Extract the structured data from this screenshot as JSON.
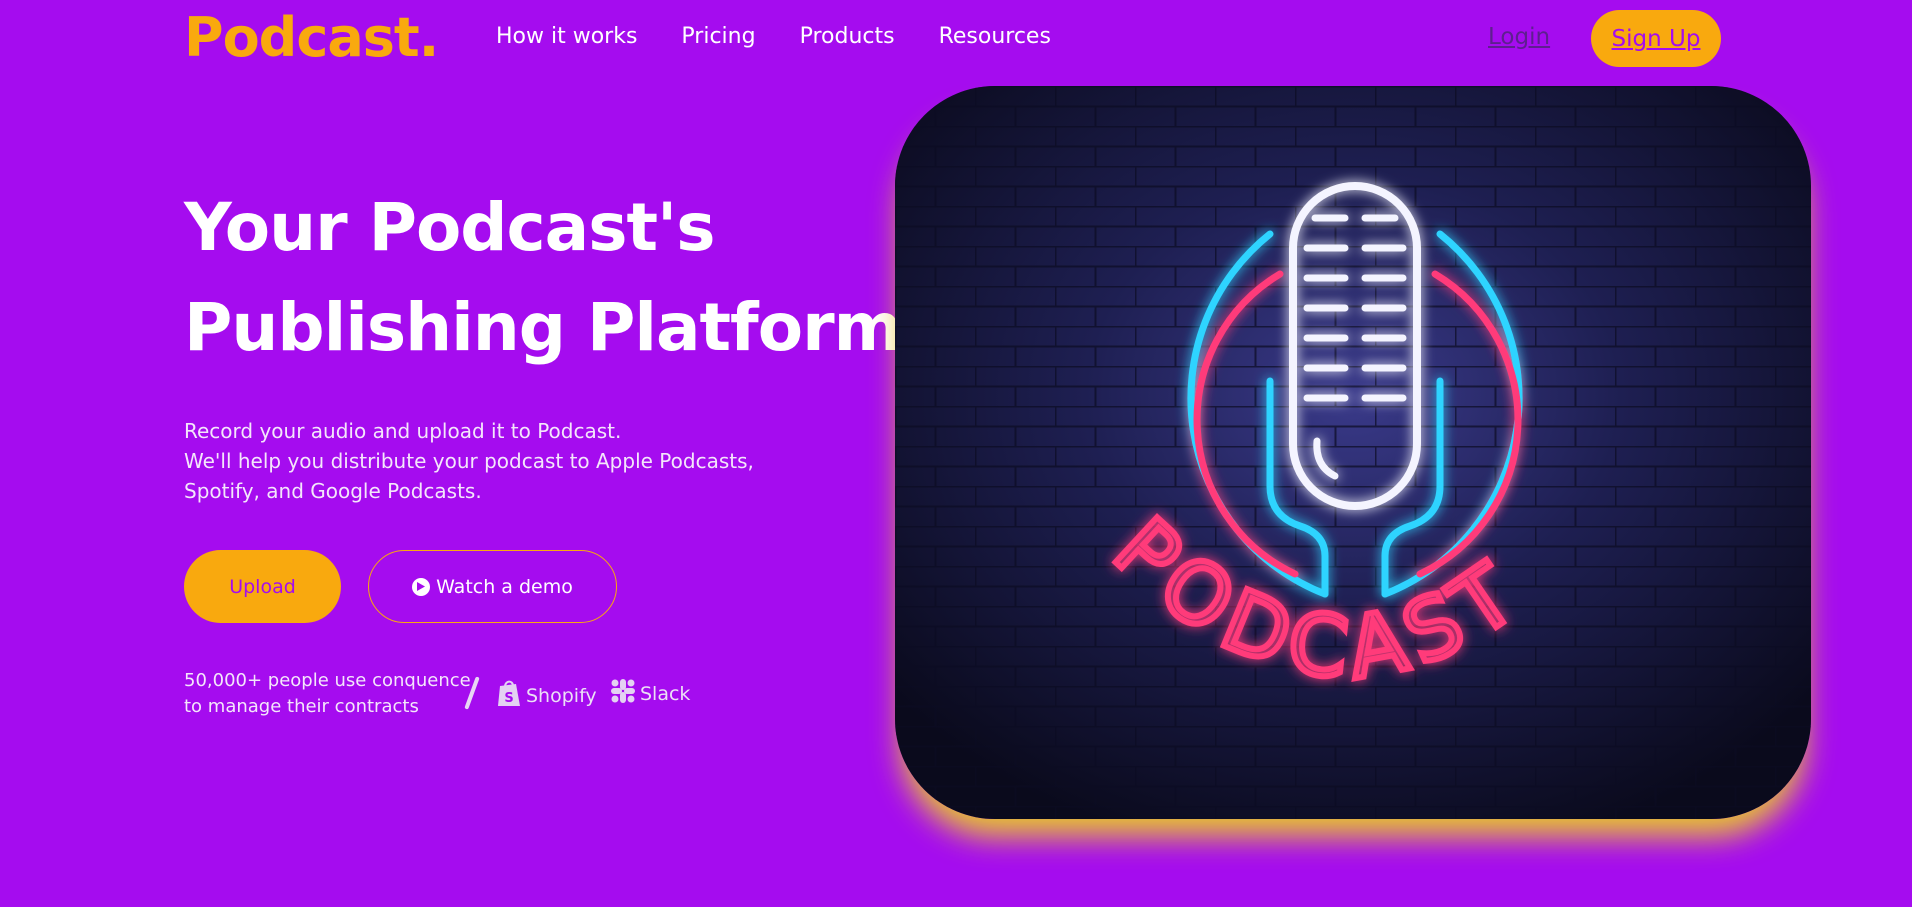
{
  "header": {
    "logo": "Podcast.",
    "nav": [
      "How it works",
      "Pricing",
      "Products",
      "Resources"
    ],
    "login": "Login",
    "signup": "Sign Up"
  },
  "hero": {
    "headline_line1": "Your Podcast's",
    "headline_line2": "Publishing Platform.",
    "sub_line1": "Record your audio and upload it to Podcast.",
    "sub_line2": "We'll help you distribute your podcast to Apple Podcasts,",
    "sub_line3": "Spotify, and Google Podcasts.",
    "upload_label": "Upload",
    "demo_label": "Watch a demo",
    "social_line1": "50,000+ people use conquence",
    "social_line2": "to manage their contracts",
    "brands": [
      "Shopify",
      "Slack"
    ]
  },
  "image": {
    "neon_text": "PODCAST"
  },
  "colors": {
    "background": "#a50cef",
    "accent": "#f9a90e",
    "neon_blue": "#2fd4ff",
    "neon_pink": "#ff3a7a"
  },
  "icons": [
    "play-icon",
    "shopify-icon",
    "slack-icon",
    "microphone-icon"
  ]
}
